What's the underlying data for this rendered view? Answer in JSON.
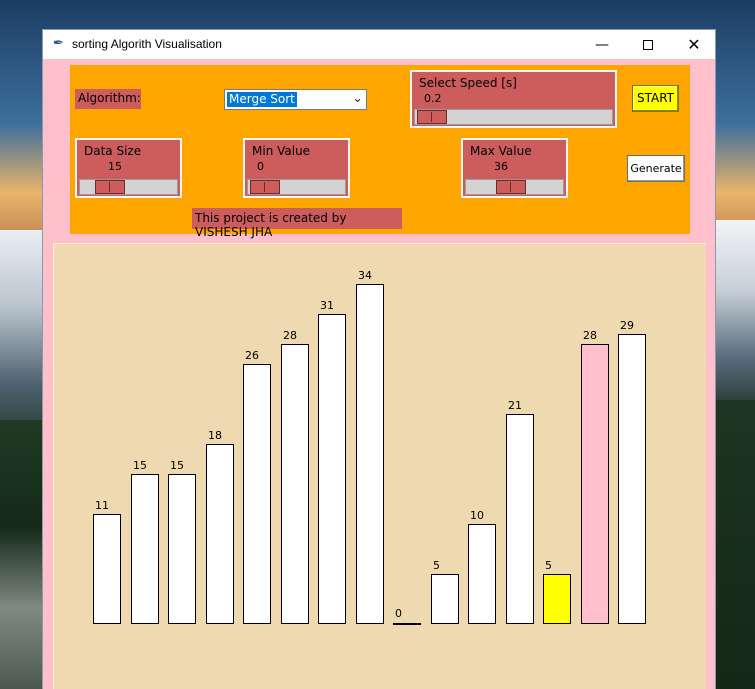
{
  "window": {
    "title": "sorting Algorith Visualisation",
    "icon": "feather-icon"
  },
  "controls": {
    "algorithm_label": "Algorithm:",
    "algorithm_selected": "Merge Sort",
    "speed": {
      "label": "Select Speed [s]",
      "value": "0.2",
      "level": 0.0
    },
    "data_size": {
      "label": "Data Size",
      "value": "15",
      "level": 0.2
    },
    "min_value": {
      "label": "Min Value",
      "value": "0",
      "level": 0.0
    },
    "max_value": {
      "label": "Max Value",
      "value": "36",
      "level": 0.45
    },
    "start_label": "START",
    "generate_label": "Generate",
    "credit": "This project is created by VISHESH JHA"
  },
  "colors": {
    "frame": "#ffa500",
    "label_bg": "#cd5c5c",
    "window_bg": "#ffc0cb",
    "canvas_bg": "#eed9b0",
    "start_bg": "#ffff00"
  },
  "chart_data": {
    "type": "bar",
    "values": [
      11,
      15,
      15,
      18,
      26,
      28,
      31,
      34,
      0,
      5,
      10,
      21,
      5,
      28,
      29
    ],
    "labels": [
      "11",
      "15",
      "15",
      "18",
      "26",
      "28",
      "31",
      "34",
      "0",
      "5",
      "10",
      "21",
      "5",
      "28",
      "29"
    ],
    "colors": [
      "#ffffff",
      "#ffffff",
      "#ffffff",
      "#ffffff",
      "#ffffff",
      "#ffffff",
      "#ffffff",
      "#ffffff",
      "#ffffff",
      "#ffffff",
      "#ffffff",
      "#ffffff",
      "#ffff00",
      "#ffc0cb",
      "#ffffff"
    ],
    "ylim": [
      0,
      34
    ]
  }
}
